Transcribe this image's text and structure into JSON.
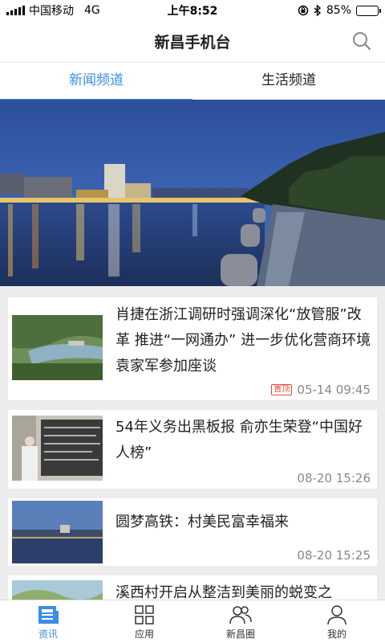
{
  "status": {
    "carrier": "中国移动",
    "network": "4G",
    "time": "上午8:52",
    "battery": "85%",
    "battery_level": 0.85
  },
  "header": {
    "title": "新昌手机台",
    "search_icon": "search-icon"
  },
  "tabs": [
    {
      "label": "新闻频道",
      "active": true
    },
    {
      "label": "生活频道",
      "active": false
    }
  ],
  "news": [
    {
      "headline": "肖捷在浙江调研时强调深化“放管服”改革 推进“一网通办” 进一步优化营商环境 袁家军参加座谈",
      "badge": "置顶",
      "time": "05-14 09:45"
    },
    {
      "headline": "54年义务出黑板报 俞亦生荣登“中国好人榜”",
      "time": "08-20 15:26"
    },
    {
      "headline": "圆梦高铁：村美民富幸福来",
      "time": "08-20 15:25"
    },
    {
      "headline": "溪西村开启从整洁到美丽的蜕变之"
    }
  ],
  "bottom_nav": [
    {
      "label": "资讯",
      "icon": "news-icon",
      "active": true
    },
    {
      "label": "应用",
      "icon": "grid-icon",
      "active": false
    },
    {
      "label": "新昌圈",
      "icon": "people-icon",
      "active": false
    },
    {
      "label": "我的",
      "icon": "user-icon",
      "active": false
    }
  ],
  "colors": {
    "accent": "#3a8ee6",
    "badge": "#e24b3b"
  }
}
